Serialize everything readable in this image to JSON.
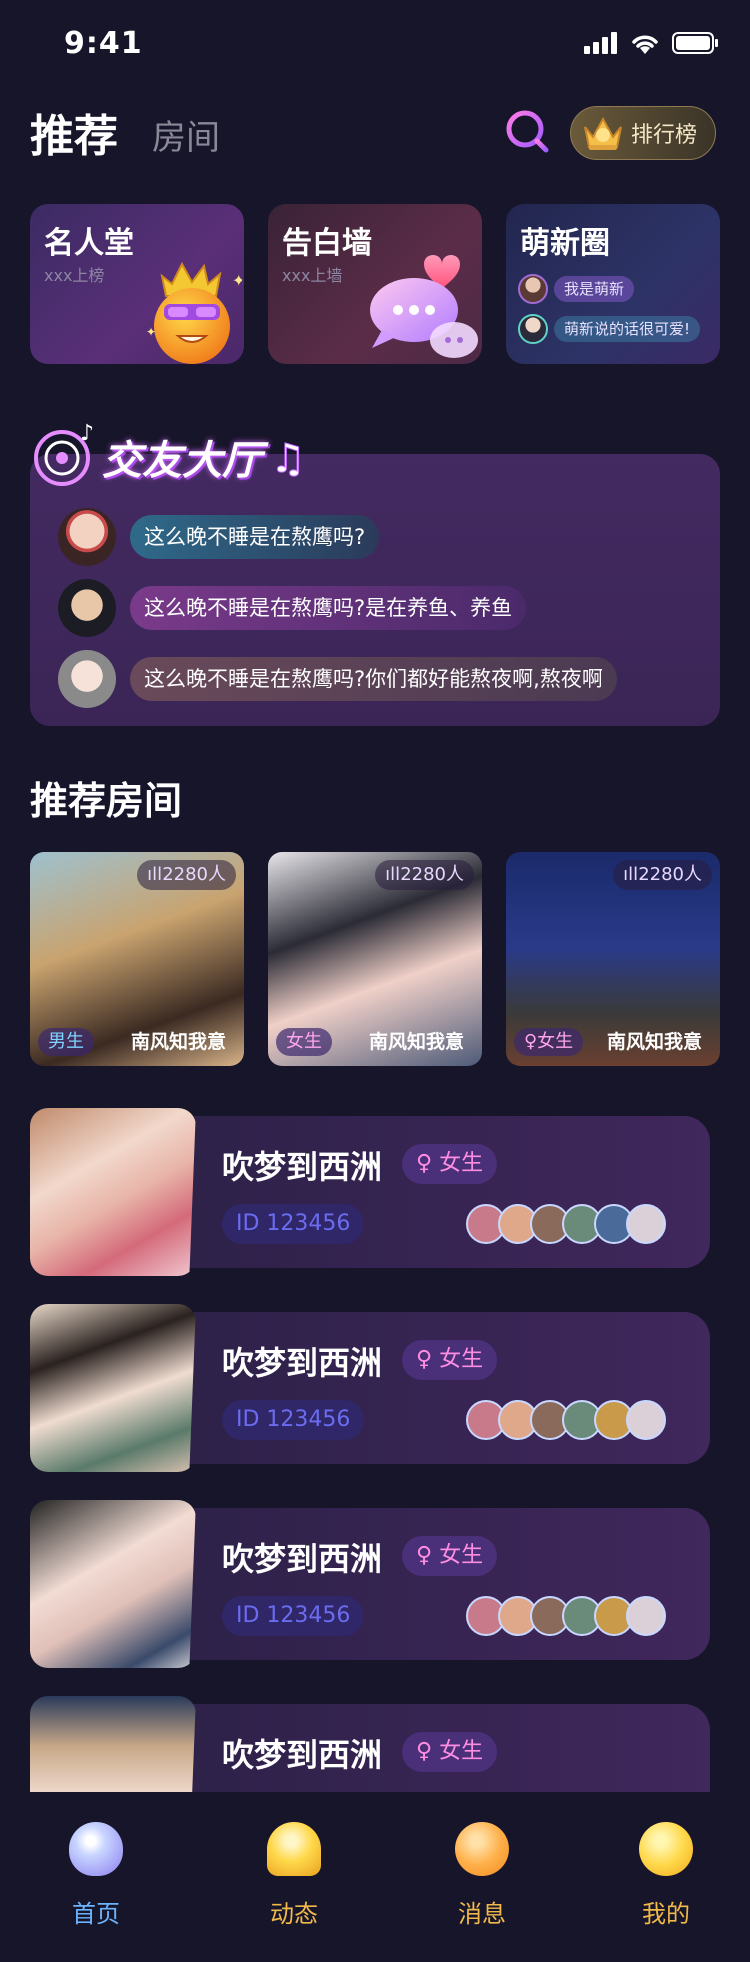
{
  "status_bar": {
    "time": "9:41"
  },
  "header": {
    "tab_active": "推荐",
    "tab_inactive": "房间",
    "rank_label": "排行榜"
  },
  "features": [
    {
      "title": "名人堂",
      "subtitle": "xxx上榜"
    },
    {
      "title": "告白墙",
      "subtitle": "xxx上墙"
    },
    {
      "title": "萌新圈",
      "chips": [
        "我是萌新",
        "萌新说的话很可爱!"
      ]
    }
  ],
  "friend_hall": {
    "title": "交友大厅",
    "messages": [
      {
        "text": "这么晚不睡是在熬鹰吗?"
      },
      {
        "text": "这么晚不睡是在熬鹰吗?是在养鱼、养鱼"
      },
      {
        "text": "这么晚不睡是在熬鹰吗?你们都好能熬夜啊,熬夜啊"
      }
    ]
  },
  "recommended": {
    "title": "推荐房间",
    "cards": [
      {
        "count": "2280人",
        "gender": "男生",
        "name": "南风知我意"
      },
      {
        "count": "2280人",
        "gender": "女生",
        "name": "南风知我意"
      },
      {
        "count": "2280人",
        "gender": "♀女生",
        "name": "南风知我意"
      }
    ]
  },
  "rooms": [
    {
      "title": "吹梦到西洲",
      "gender": "♀ 女生",
      "id": "ID 123456"
    },
    {
      "title": "吹梦到西洲",
      "gender": "♀ 女生",
      "id": "ID 123456"
    },
    {
      "title": "吹梦到西洲",
      "gender": "♀ 女生",
      "id": "ID 123456"
    },
    {
      "title": "吹梦到西洲",
      "gender": "♀ 女生",
      "id": ""
    }
  ],
  "nav": [
    {
      "label": "首页",
      "icon": "heart-icon",
      "color": "#6ab3ff"
    },
    {
      "label": "动态",
      "icon": "bell-icon",
      "color": "#f0b94a"
    },
    {
      "label": "消息",
      "icon": "chat-bubble-icon",
      "color": "#f0b94a"
    },
    {
      "label": "我的",
      "icon": "smiley-icon",
      "color": "#f0b94a"
    }
  ],
  "colors": {
    "background": "#17152a",
    "accent_pink": "#ff8ee2",
    "accent_purple": "#6b6cf0"
  }
}
